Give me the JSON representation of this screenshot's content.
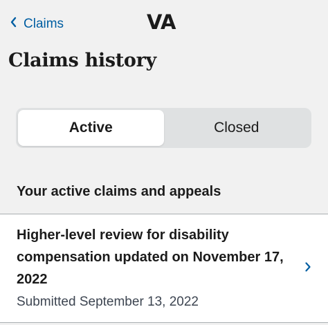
{
  "header": {
    "back_label": "Claims",
    "logo_text": "VA"
  },
  "page": {
    "title": "Claims history"
  },
  "tabs": [
    {
      "label": "Active",
      "selected": true
    },
    {
      "label": "Closed",
      "selected": false
    }
  ],
  "section": {
    "heading": "Your active claims and appeals"
  },
  "claims": [
    {
      "title": "Higher-level review for disability compensation updated on November 17, 2022",
      "subtitle": "Submitted September 13, 2022"
    }
  ],
  "colors": {
    "link": "#005ea2",
    "background": "#f1f1f1"
  },
  "icons": {
    "back": "chevron-left-icon",
    "item": "chevron-right-icon"
  }
}
